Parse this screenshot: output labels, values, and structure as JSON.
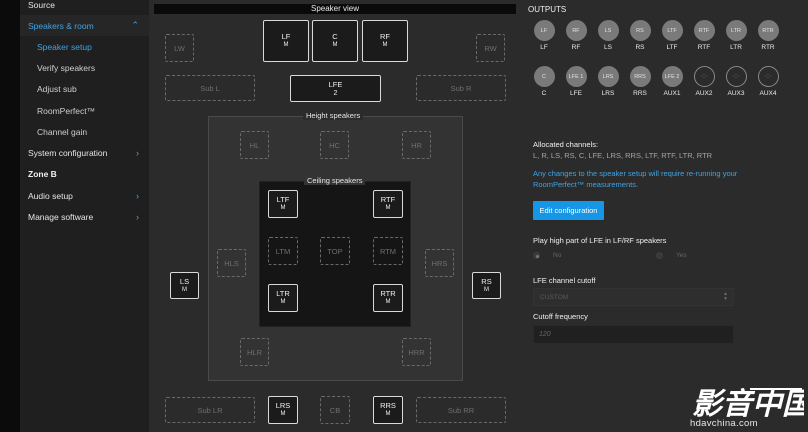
{
  "sidebar": {
    "source": "Source",
    "speakers_room": "Speakers & room",
    "speaker_setup": "Speaker setup",
    "verify_speakers": "Verify speakers",
    "adjust_sub": "Adjust sub",
    "roomperfect": "RoomPerfect™",
    "channel_gain": "Channel gain",
    "system_configuration": "System configuration",
    "zone_b": "Zone B",
    "audio_setup": "Audio setup",
    "manage_software": "Manage software"
  },
  "speaker_view": {
    "title": "Speaker view",
    "lw": "LW",
    "rw": "RW",
    "lf": "LF",
    "c": "C",
    "rf": "RF",
    "m": "M",
    "sub_l": "Sub L",
    "sub_r": "Sub R",
    "lfe": "LFE",
    "lfe_count": "2",
    "height_label": "Height speakers",
    "hl": "HL",
    "hc": "HC",
    "hr": "HR",
    "ceiling_label": "Ceiling speakers",
    "ltf": "LTF",
    "rtf": "RTF",
    "ltm": "LTM",
    "top": "TOP",
    "rtm": "RTM",
    "ltr": "LTR",
    "rtr": "RTR",
    "hls": "HLS",
    "hrs": "HRS",
    "ls": "LS",
    "rs": "RS",
    "hlr": "HLR",
    "hrr": "HRR",
    "sub_lr": "Sub LR",
    "lrs": "LRS",
    "cb": "CB",
    "rrs": "RRS",
    "sub_rr": "Sub RR"
  },
  "outputs": {
    "title": "OUTPUTS",
    "row1": [
      {
        "circle": "LF",
        "label": "LF"
      },
      {
        "circle": "RF",
        "label": "RF"
      },
      {
        "circle": "LS",
        "label": "LS"
      },
      {
        "circle": "RS",
        "label": "RS"
      },
      {
        "circle": "LTF",
        "label": "LTF"
      },
      {
        "circle": "RTF",
        "label": "RTF"
      },
      {
        "circle": "LTR",
        "label": "LTR"
      },
      {
        "circle": "RTR",
        "label": "RTR"
      }
    ],
    "row2": [
      {
        "circle": "C",
        "label": "C"
      },
      {
        "circle": "LFE 1",
        "label": "LFE"
      },
      {
        "circle": "LRS",
        "label": "LRS"
      },
      {
        "circle": "RRS",
        "label": "RRS"
      },
      {
        "circle": "LFE 2",
        "label": "AUX1"
      },
      {
        "circle": "·:·",
        "label": "AUX2"
      },
      {
        "circle": "·:·",
        "label": "AUX3"
      },
      {
        "circle": "·:·",
        "label": "AUX4"
      }
    ]
  },
  "config": {
    "allocated_title": "Allocated channels:",
    "allocated_list": "L, R, LS, RS, C, LFE, LRS, RRS, LTF, RTF, LTR, RTR",
    "warning_line1": "Any changes to the speaker setup will require re-running your",
    "warning_line2": "RoomPerfect™ measurements.",
    "edit_button": "Edit configuration",
    "play_high_label": "Play high part of LFE in LF/RF speakers",
    "no": "No",
    "yes": "Yes",
    "lfe_cutoff_label": "LFE channel cutoff",
    "lfe_cutoff_value": "CUSTOM",
    "cutoff_freq_label": "Cutoff frequency",
    "cutoff_freq_placeholder": "120"
  },
  "watermark": {
    "chars": "影音中国",
    "url": "hdavchina.com"
  }
}
